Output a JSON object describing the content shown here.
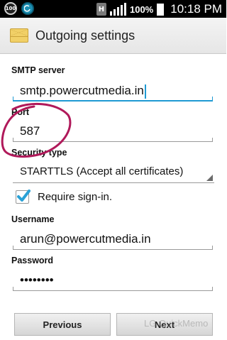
{
  "status_bar": {
    "icon_left_1": "100",
    "icon_left_2": "",
    "network_badge": "H",
    "battery_percent": "100%",
    "time": "10:18 PM"
  },
  "title_bar": {
    "title": "Outgoing settings",
    "icon": "mail-envelope-icon"
  },
  "form": {
    "smtp_server": {
      "label": "SMTP server",
      "value": "smtp.powercutmedia.in"
    },
    "port": {
      "label": "Port",
      "value": "587"
    },
    "security_type": {
      "label": "Security type",
      "value": "STARTTLS (Accept all certificates)"
    },
    "require_signin": {
      "label": "Require sign-in.",
      "checked": true
    },
    "username": {
      "label": "Username",
      "value": "arun@powercutmedia.in"
    },
    "password": {
      "label": "Password",
      "value": "••••••••"
    }
  },
  "buttons": {
    "previous": "Previous",
    "next": "Next"
  },
  "watermark": "LG QuickMemo",
  "colors": {
    "accent": "#1f9ad3",
    "annotation": "#b0195a",
    "checkbox_check": "#2aa1d6"
  }
}
